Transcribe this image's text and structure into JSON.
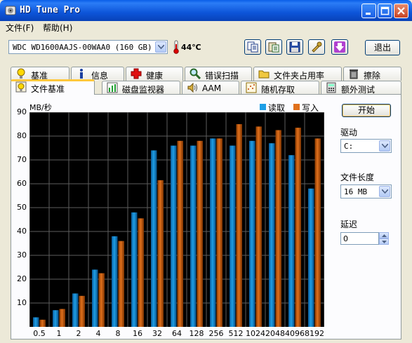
{
  "window": {
    "title": "HD Tune Pro"
  },
  "menu": [
    {
      "label": "文件(F)"
    },
    {
      "label": "帮助(H)"
    }
  ],
  "toolbar": {
    "drive": "WDC WD1600AAJS-00WAA0 (160 GB)",
    "temperature": "44℃",
    "exit_label": "退出"
  },
  "tabs_row1": [
    {
      "label": "基准",
      "icon": "bulb-icon"
    },
    {
      "label": "信息",
      "icon": "info-icon"
    },
    {
      "label": "健康",
      "icon": "red-cross-icon"
    },
    {
      "label": "错误扫描",
      "icon": "magnifier-icon"
    },
    {
      "label": "文件夹占用率",
      "icon": "folder-icon"
    },
    {
      "label": "擦除",
      "icon": "trash-icon"
    }
  ],
  "tabs_row2": [
    {
      "label": "文件基准",
      "icon": "file-bulb-icon",
      "active": true
    },
    {
      "label": "磁盘监视器",
      "icon": "bar-chart-icon"
    },
    {
      "label": "AAM",
      "icon": "speaker-icon"
    },
    {
      "label": "随机存取",
      "icon": "scatter-icon"
    },
    {
      "label": "额外测试",
      "icon": "calculator-icon"
    }
  ],
  "controls": {
    "start_label": "开始",
    "drive_label": "驱动",
    "drive_value": "C:",
    "file_length_label": "文件长度",
    "file_length_value": "16 MB",
    "delay_label": "延迟",
    "delay_value": "0"
  },
  "colors": {
    "read": "#1E9FE6",
    "write": "#E0701C"
  },
  "chart_data": {
    "type": "bar",
    "ylabel": "MB/秒",
    "ylim": [
      0,
      90
    ],
    "yticks": [
      10,
      20,
      30,
      40,
      50,
      60,
      70,
      80,
      90
    ],
    "categories": [
      "0.5",
      "1",
      "2",
      "4",
      "8",
      "16",
      "32",
      "64",
      "128",
      "256",
      "512",
      "1024",
      "2048",
      "4096",
      "8192"
    ],
    "series": [
      {
        "name": "读取",
        "values": [
          4,
          7,
          14,
          24,
          38,
          48,
          74,
          76,
          76,
          79,
          76,
          78,
          77,
          72,
          58
        ]
      },
      {
        "name": "写入",
        "values": [
          3,
          7.5,
          13,
          22.5,
          36,
          45.5,
          61.5,
          78,
          78,
          79,
          85,
          84,
          82.5,
          83.5,
          79
        ]
      }
    ],
    "grid": true,
    "legend": "top-right"
  }
}
